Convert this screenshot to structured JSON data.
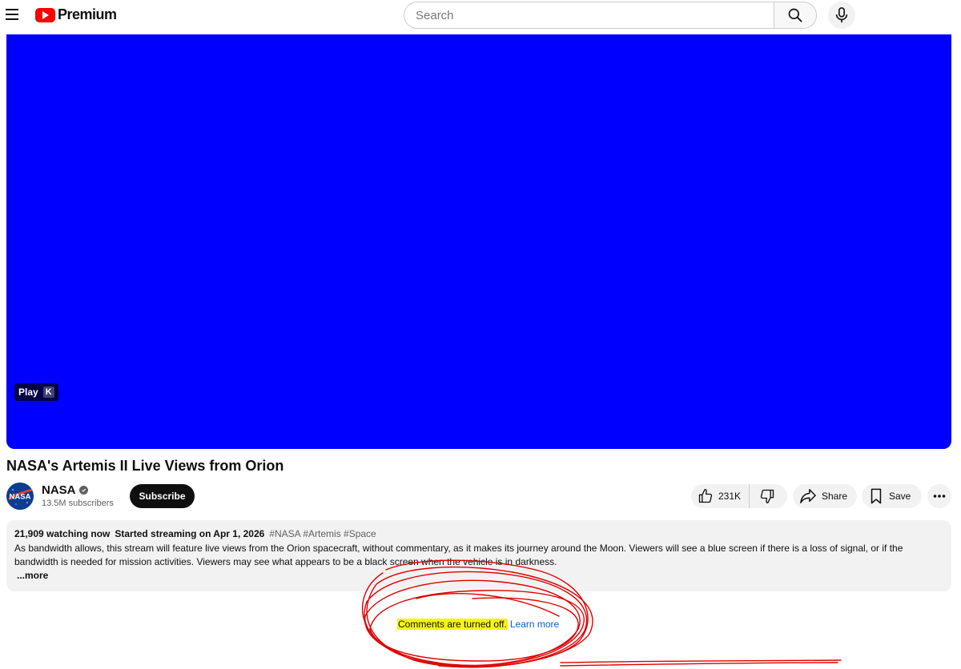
{
  "header": {
    "logo_text": "Premium",
    "search_placeholder": "Search"
  },
  "player": {
    "background_color": "#0000fe",
    "tooltip_label": "Play",
    "tooltip_key": "K"
  },
  "video": {
    "title": "NASA's Artemis II Live Views from Orion"
  },
  "channel": {
    "name": "NASA",
    "subscribers": "13.5M subscribers",
    "subscribe_label": "Subscribe",
    "avatar_text": "NASA"
  },
  "actions": {
    "likes": "231K",
    "share_label": "Share",
    "save_label": "Save"
  },
  "description": {
    "watching": "21,909 watching now",
    "started": "Started streaming on Apr 1, 2026",
    "hashtags": "#NASA #Artemis #Space",
    "text": "As bandwidth allows, this stream will feature live views from the Orion spacecraft, without commentary, as it makes its journey around the Moon. Viewers will see a blue screen if there is a loss of signal, or if the bandwidth is needed for mission activities. Viewers may see what appears to be a black screen when the vehicle is in darkness.",
    "more_label": "...more"
  },
  "comments": {
    "status_text": "Comments are turned off.",
    "learn_more_label": "Learn more",
    "highlight_color": "#f5f700",
    "annotation_color": "#e00000"
  }
}
